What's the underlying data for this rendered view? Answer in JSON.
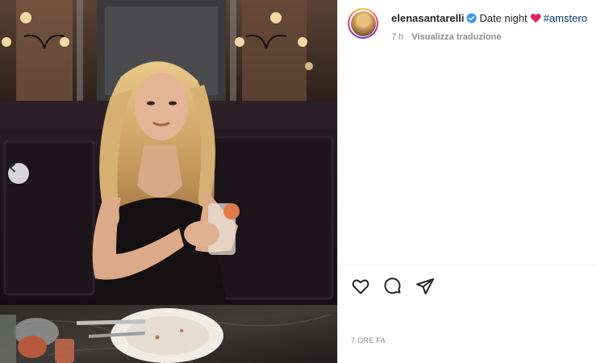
{
  "post": {
    "username": "elenasantarelli",
    "caption_text": "Date night",
    "hashtag": "#amstero",
    "time_ago": "7 h",
    "translate_label": "Visualizza traduzione",
    "timestamp": "7 ORE FA"
  },
  "icons": {
    "prev": "chevron-left-icon",
    "verified": "verified-badge-icon",
    "heart_emoji": "red-heart-icon",
    "like": "heart-icon",
    "comment": "comment-icon",
    "share": "paper-plane-icon"
  },
  "colors": {
    "verified_blue": "#3897f0",
    "heart_red": "#e0245e",
    "hashtag_blue": "#00376b",
    "meta_gray": "#8e8e8e"
  }
}
